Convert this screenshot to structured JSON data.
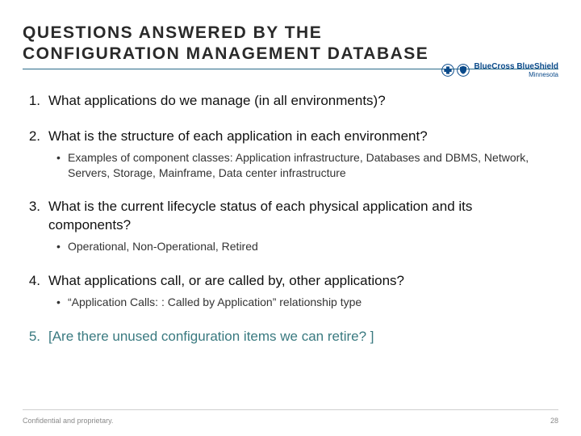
{
  "title_line1": "QUESTIONS ANSWERED BY THE",
  "title_line2": "CONFIGURATION MANAGEMENT DATABASE",
  "logo": {
    "main": "BlueCross BlueShield",
    "sub": "Minnesota"
  },
  "questions": [
    {
      "num": "1.",
      "text": "What applications do we manage (in all environments)?",
      "subs": []
    },
    {
      "num": "2.",
      "text": "What is the structure of each application in each environment?",
      "subs": [
        "Examples of component classes: Application infrastructure, Databases and DBMS, Network, Servers, Storage, Mainframe, Data center infrastructure"
      ]
    },
    {
      "num": "3.",
      "text": "What is the current lifecycle status of each physical application and its components?",
      "subs": [
        "Operational, Non-Operational, Retired"
      ]
    },
    {
      "num": "4.",
      "text": "What applications call, or are called by, other applications?",
      "subs": [
        "“Application Calls: : Called by Application” relationship type"
      ]
    },
    {
      "num": "5.",
      "text": "[Are there unused configuration items we can retire? ]",
      "subs": []
    }
  ],
  "footer": {
    "confidential": "Confidential and proprietary.",
    "page": "28"
  }
}
